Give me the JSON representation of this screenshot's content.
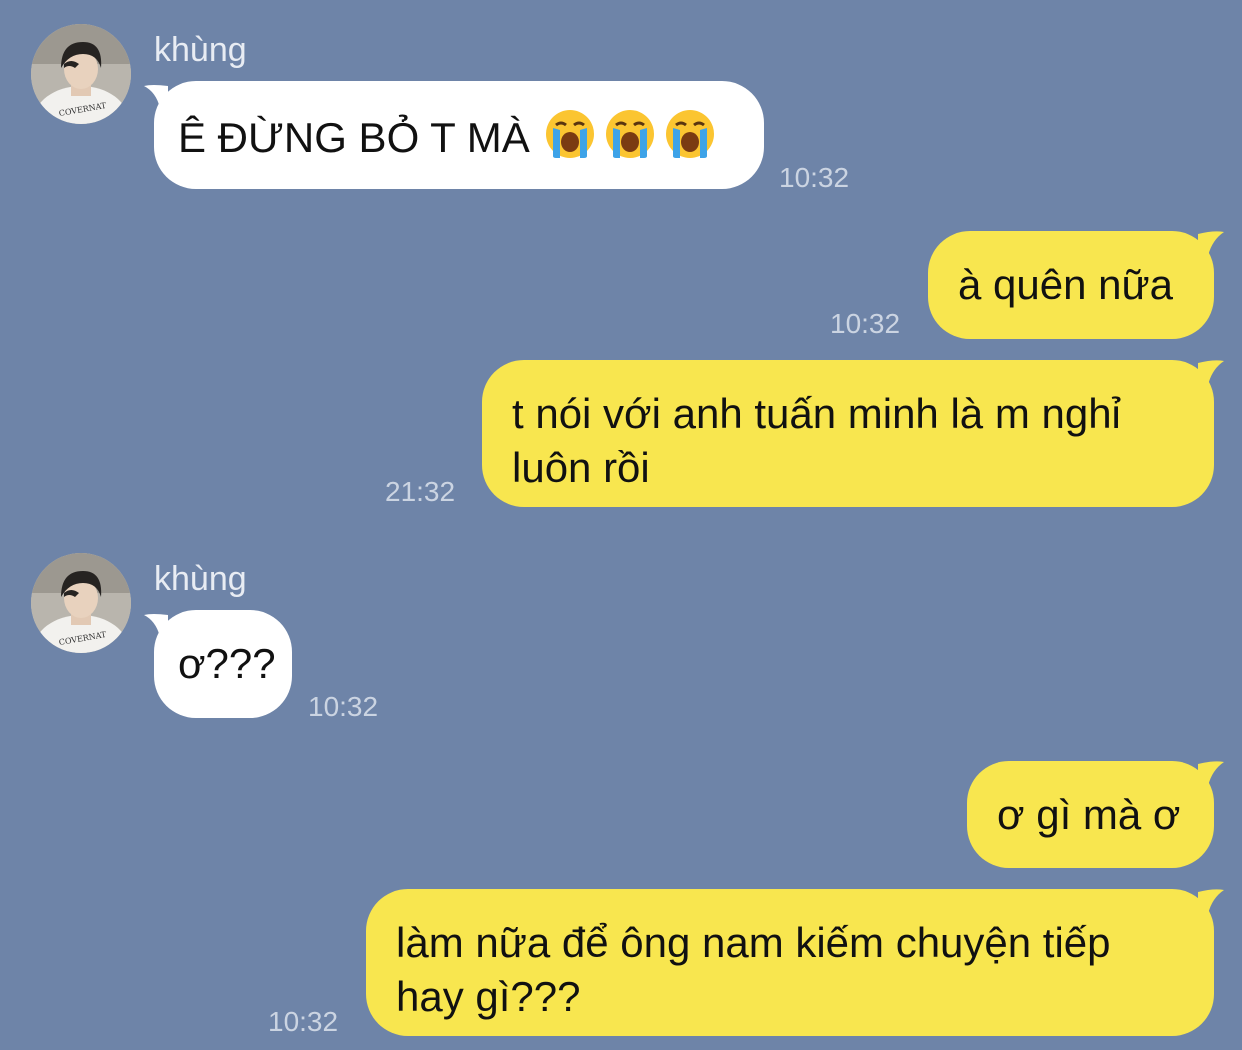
{
  "theme": {
    "background": "#6e84a8",
    "incoming_bubble": "#ffffff",
    "outgoing_bubble": "#f8e64f",
    "timestamp_color": "#cbd4e2"
  },
  "messages": [
    {
      "direction": "incoming",
      "sender": "khùng",
      "text": "Ê ĐỪNG BỎ T MÀ",
      "emojis": [
        "loudly-crying-face",
        "loudly-crying-face",
        "loudly-crying-face"
      ],
      "time": "10:32"
    },
    {
      "direction": "outgoing",
      "text": "à quên nữa",
      "time": "10:32"
    },
    {
      "direction": "outgoing",
      "lines": [
        "t nói với anh tuấn minh là m nghỉ",
        "luôn rồi"
      ],
      "time": "21:32"
    },
    {
      "direction": "incoming",
      "sender": "khùng",
      "text": "ơ???",
      "time": "10:32"
    },
    {
      "direction": "outgoing",
      "text": "ơ gì mà ơ",
      "time": "10:32"
    },
    {
      "direction": "outgoing",
      "lines": [
        "làm nữa để ông nam kiếm chuyện tiếp",
        "hay gì???"
      ],
      "time": "10:32"
    }
  ]
}
